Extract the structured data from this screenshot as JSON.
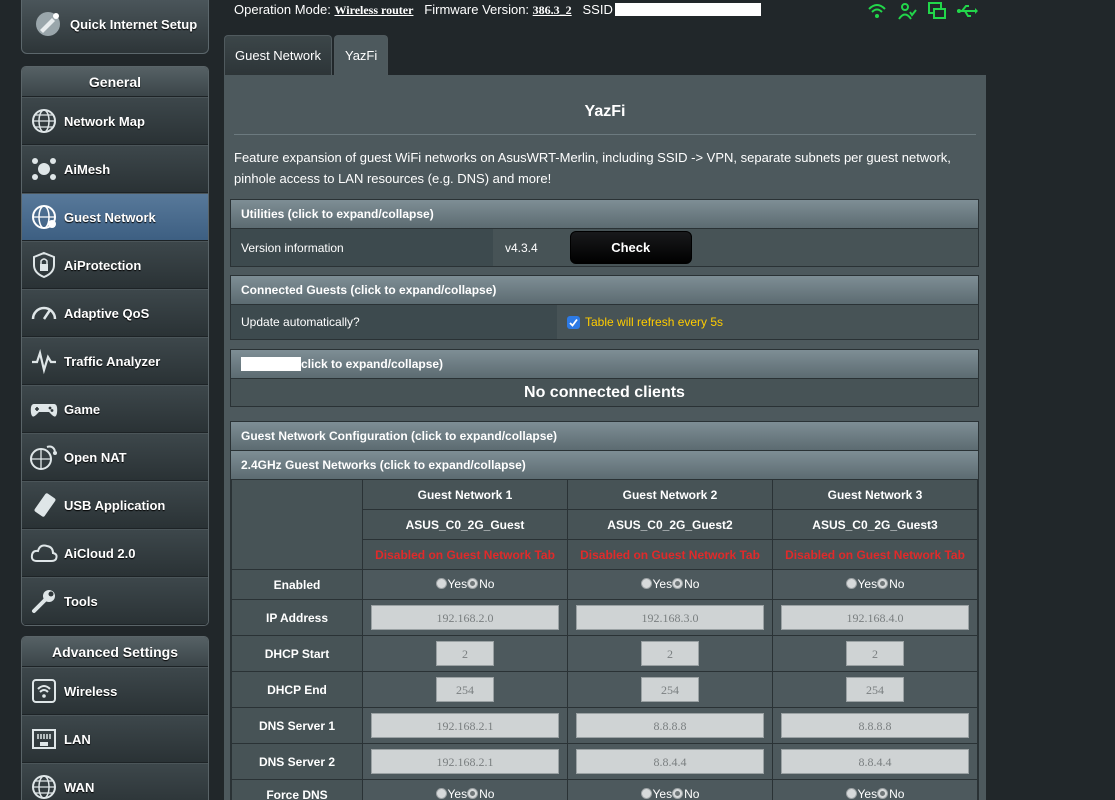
{
  "menu": {
    "quick_setup": "Quick Internet Setup",
    "general_header": "General",
    "general_items": [
      {
        "label": "Network Map",
        "icon": "globe-network-icon"
      },
      {
        "label": "AiMesh",
        "icon": "mesh-icon"
      },
      {
        "label": "Guest Network",
        "icon": "guest-globe-icon",
        "active": true
      },
      {
        "label": "AiProtection",
        "icon": "shield-lock-icon"
      },
      {
        "label": "Adaptive QoS",
        "icon": "gauge-icon"
      },
      {
        "label": "Traffic Analyzer",
        "icon": "pulse-icon"
      },
      {
        "label": "Game",
        "icon": "gamepad-icon"
      },
      {
        "label": "Open NAT",
        "icon": "open-nat-icon"
      },
      {
        "label": "USB Application",
        "icon": "usb-icon"
      },
      {
        "label": "AiCloud 2.0",
        "icon": "cloud-icon"
      },
      {
        "label": "Tools",
        "icon": "wrench-icon"
      }
    ],
    "advanced_header": "Advanced Settings",
    "advanced_items": [
      {
        "label": "Wireless",
        "icon": "wireless-icon"
      },
      {
        "label": "LAN",
        "icon": "lan-port-icon"
      },
      {
        "label": "WAN",
        "icon": "wan-globe-icon"
      }
    ]
  },
  "topbar": {
    "op_mode_label": "Operation Mode:",
    "op_mode_value": "Wireless router",
    "firmware_label": "Firmware Version:",
    "firmware_value": "386.3_2",
    "ssid_label": "SSID"
  },
  "tabs": [
    "Guest Network",
    "YazFi"
  ],
  "panel": {
    "title": "YazFi",
    "description": "Feature expansion of guest WiFi networks on AsusWRT-Merlin, including SSID -> VPN, separate subnets per guest network, pinhole access to LAN resources (e.g. DNS) and more!",
    "utilities_header": "Utilities (click to expand/collapse)",
    "version_label": "Version information",
    "version_value": "v4.3.4",
    "check_button": "Check",
    "connected_header": "Connected Guests (click to expand/collapse)",
    "update_label": "Update automatically?",
    "refresh_text": "Table will refresh every 5s",
    "masked_header_suffix": "click to expand/collapse)",
    "no_clients": "No connected clients",
    "config_header": "Guest Network Configuration (click to expand/collapse)",
    "band_header": "2.4GHz Guest Networks (click to expand/collapse)"
  },
  "config": {
    "networks": [
      {
        "name": "Guest Network 1",
        "ssid": "ASUS_C0_2G_Guest",
        "status": "Disabled on Guest Network Tab",
        "ip": "192.168.2.0",
        "dhcp_start": "2",
        "dhcp_end": "254",
        "dns1": "192.168.2.1",
        "dns2": "192.168.2.1"
      },
      {
        "name": "Guest Network 2",
        "ssid": "ASUS_C0_2G_Guest2",
        "status": "Disabled on Guest Network Tab",
        "ip": "192.168.3.0",
        "dhcp_start": "2",
        "dhcp_end": "254",
        "dns1": "8.8.8.8",
        "dns2": "8.8.4.4"
      },
      {
        "name": "Guest Network 3",
        "ssid": "ASUS_C0_2G_Guest3",
        "status": "Disabled on Guest Network Tab",
        "ip": "192.168.4.0",
        "dhcp_start": "2",
        "dhcp_end": "254",
        "dns1": "8.8.8.8",
        "dns2": "8.8.4.4"
      }
    ],
    "labels": {
      "enabled": "Enabled",
      "ip": "IP Address",
      "dhcp_start": "DHCP Start",
      "dhcp_end": "DHCP End",
      "dns1": "DNS Server 1",
      "dns2": "DNS Server 2",
      "force_dns": "Force DNS"
    },
    "yes": "Yes",
    "no": "No"
  }
}
